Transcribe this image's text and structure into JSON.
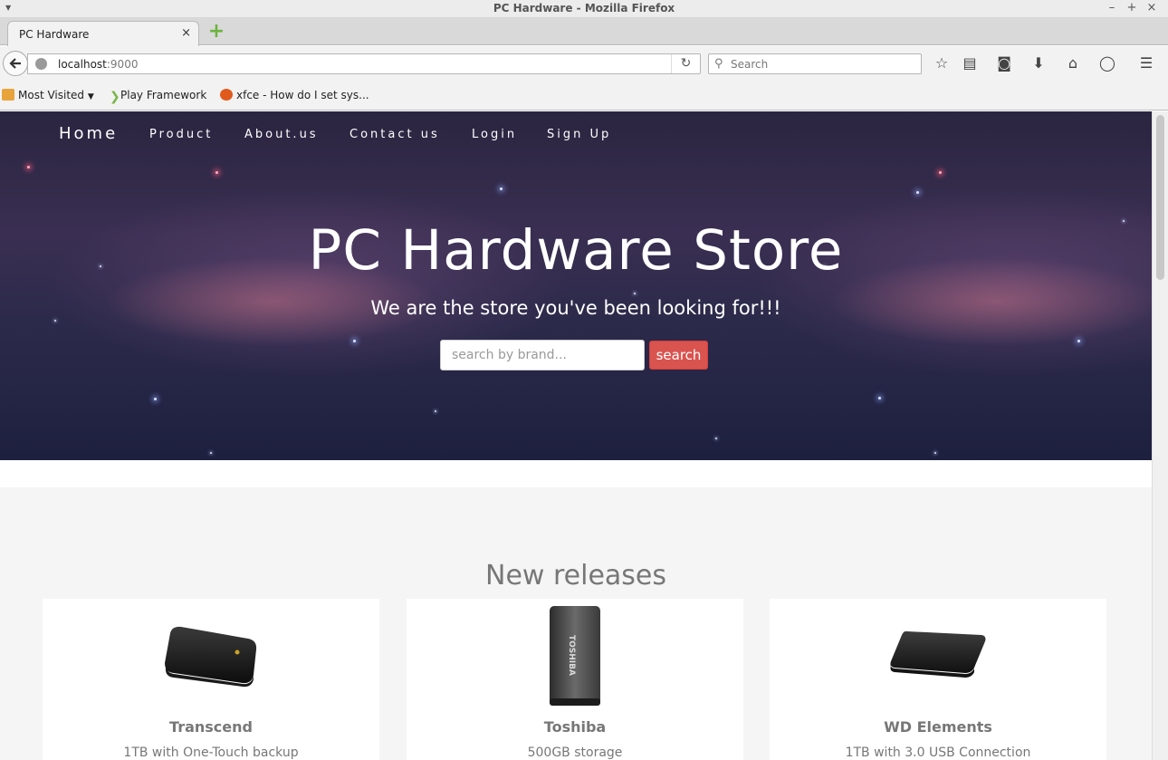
{
  "window": {
    "title": "PC Hardware - Mozilla Firefox",
    "controls": {
      "minimize": "–",
      "maximize": "+",
      "close": "×"
    }
  },
  "tabs": [
    {
      "label": "PC Hardware",
      "close": "×"
    }
  ],
  "navbar": {
    "url_host": "localhost",
    "url_port": ":9000",
    "search_placeholder": "Search"
  },
  "bookmarks": [
    {
      "label": "Most Visited",
      "icon": "folder-icon"
    },
    {
      "label": "Play Framework",
      "icon": "play-icon"
    },
    {
      "label": "xfce - How do I set sys...",
      "icon": "ask-icon"
    }
  ],
  "site_nav": {
    "home": "Home",
    "product": "Product",
    "about": "About.us",
    "contact": "Contact us",
    "login": "Login",
    "signup": "Sign Up"
  },
  "hero": {
    "title": "PC Hardware Store",
    "subtitle": "We are the store you've been looking for!!!",
    "search_placeholder": "search by brand...",
    "search_button": "search"
  },
  "new_releases": {
    "title": "New releases",
    "products": [
      {
        "name": "Transcend",
        "description": "1TB with One-Touch backup"
      },
      {
        "name": "Toshiba",
        "description": "500GB storage",
        "label": "TOSHIBA"
      },
      {
        "name": "WD Elements",
        "description": "1TB with 3.0 USB Connection"
      }
    ]
  },
  "colors": {
    "accent": "#d9534f",
    "muted_text": "#777777"
  }
}
